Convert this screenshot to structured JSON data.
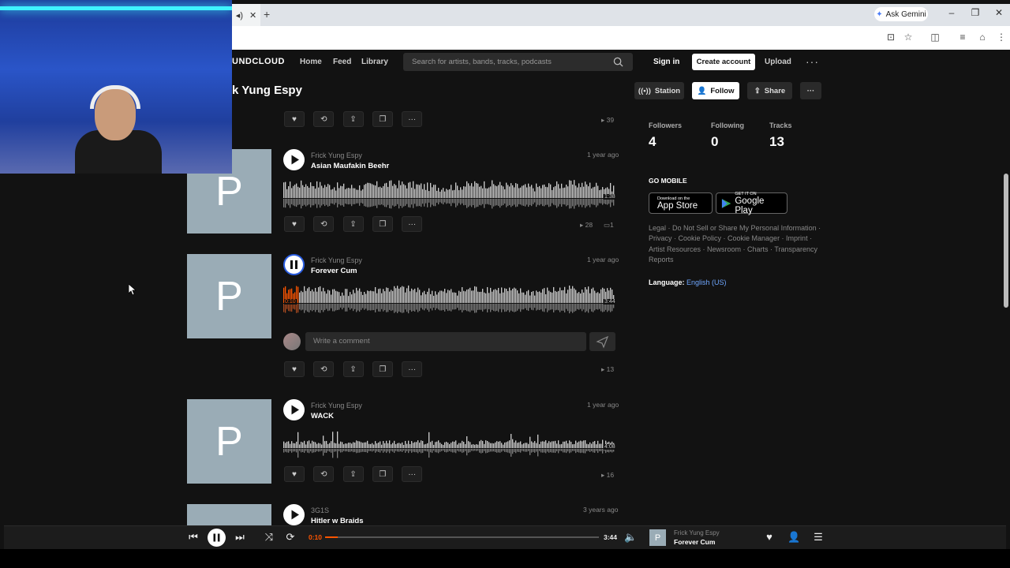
{
  "browser": {
    "tab_close": "✕",
    "new_tab": "+",
    "ask_gemini": "Ask Gemini",
    "win_minimize": "–",
    "win_restore": "❐",
    "win_close": "✕"
  },
  "header": {
    "logo": "UNDCLOUD",
    "nav": [
      "Home",
      "Feed",
      "Library"
    ],
    "search_placeholder": "Search for artists, bands, tracks, podcasts",
    "signin": "Sign in",
    "create_account": "Create account",
    "upload": "Upload",
    "more": "···"
  },
  "profile": {
    "name": "k Yung Espy",
    "station": "Station",
    "follow": "Follow",
    "share": "Share",
    "more": "···"
  },
  "first_row": {
    "plays": "39"
  },
  "tracks": [
    {
      "artist": "Frick Yung Espy",
      "title": "Asian Maufakin Beehr",
      "ago": "1 year ago",
      "duration": "1:38",
      "plays": "28",
      "comments": "1",
      "playing": false,
      "progress": 0
    },
    {
      "artist": "Frick Yung Espy",
      "title": "Forever Cum",
      "ago": "1 year ago",
      "elapsed": "0:10",
      "duration": "3:44",
      "plays": "13",
      "playing": true,
      "progress": 0.045
    },
    {
      "artist": "Frick Yung Espy",
      "title": "WACK",
      "ago": "1 year ago",
      "duration": "4:08",
      "plays": "16",
      "playing": false,
      "progress": 0
    },
    {
      "artist": "3G1S",
      "title": "Hitler w Braids",
      "ago": "3 years ago",
      "playing": false,
      "progress": 0
    }
  ],
  "cover_letter": "P",
  "comment": {
    "placeholder": "Write a comment"
  },
  "stats": {
    "followers_label": "Followers",
    "followers": "4",
    "following_label": "Following",
    "following": "0",
    "tracks_label": "Tracks",
    "tracks": "13"
  },
  "mobile": {
    "title": "GO MOBILE",
    "appstore_small": "Download on the",
    "appstore_big": "App Store",
    "googleplay_small": "GET IT ON",
    "googleplay_big": "Google Play"
  },
  "legal": {
    "text": "Legal · Do Not Sell or Share My Personal Information · Privacy · Cookie Policy · Cookie Manager · Imprint · Artist Resources · Newsroom · Charts · Transparency Reports",
    "language_label": "Language:",
    "language_value": "English (US)"
  },
  "player": {
    "current": "0:10",
    "duration": "3:44",
    "progress": 0.045,
    "artist": "Frick Yung Espy",
    "title": "Forever Cum",
    "thumb_letter": "P"
  },
  "colors": {
    "accent": "#ff5500",
    "bg": "#121212"
  }
}
